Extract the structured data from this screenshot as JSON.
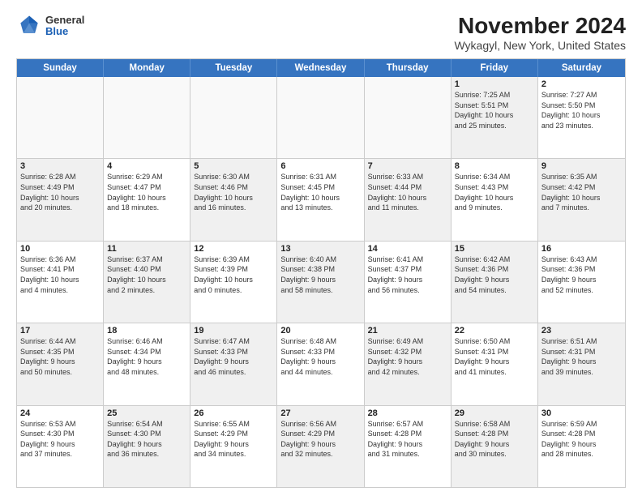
{
  "logo": {
    "general": "General",
    "blue": "Blue"
  },
  "title": "November 2024",
  "subtitle": "Wykagyl, New York, United States",
  "header": {
    "days": [
      "Sunday",
      "Monday",
      "Tuesday",
      "Wednesday",
      "Thursday",
      "Friday",
      "Saturday"
    ]
  },
  "weeks": [
    [
      {
        "day": "",
        "info": "",
        "empty": true
      },
      {
        "day": "",
        "info": "",
        "empty": true
      },
      {
        "day": "",
        "info": "",
        "empty": true
      },
      {
        "day": "",
        "info": "",
        "empty": true
      },
      {
        "day": "",
        "info": "",
        "empty": true
      },
      {
        "day": "1",
        "info": "Sunrise: 7:25 AM\nSunset: 5:51 PM\nDaylight: 10 hours\nand 25 minutes.",
        "shaded": true
      },
      {
        "day": "2",
        "info": "Sunrise: 7:27 AM\nSunset: 5:50 PM\nDaylight: 10 hours\nand 23 minutes.",
        "shaded": false
      }
    ],
    [
      {
        "day": "3",
        "info": "Sunrise: 6:28 AM\nSunset: 4:49 PM\nDaylight: 10 hours\nand 20 minutes.",
        "shaded": true
      },
      {
        "day": "4",
        "info": "Sunrise: 6:29 AM\nSunset: 4:47 PM\nDaylight: 10 hours\nand 18 minutes.",
        "shaded": false
      },
      {
        "day": "5",
        "info": "Sunrise: 6:30 AM\nSunset: 4:46 PM\nDaylight: 10 hours\nand 16 minutes.",
        "shaded": true
      },
      {
        "day": "6",
        "info": "Sunrise: 6:31 AM\nSunset: 4:45 PM\nDaylight: 10 hours\nand 13 minutes.",
        "shaded": false
      },
      {
        "day": "7",
        "info": "Sunrise: 6:33 AM\nSunset: 4:44 PM\nDaylight: 10 hours\nand 11 minutes.",
        "shaded": true
      },
      {
        "day": "8",
        "info": "Sunrise: 6:34 AM\nSunset: 4:43 PM\nDaylight: 10 hours\nand 9 minutes.",
        "shaded": false
      },
      {
        "day": "9",
        "info": "Sunrise: 6:35 AM\nSunset: 4:42 PM\nDaylight: 10 hours\nand 7 minutes.",
        "shaded": true
      }
    ],
    [
      {
        "day": "10",
        "info": "Sunrise: 6:36 AM\nSunset: 4:41 PM\nDaylight: 10 hours\nand 4 minutes.",
        "shaded": false
      },
      {
        "day": "11",
        "info": "Sunrise: 6:37 AM\nSunset: 4:40 PM\nDaylight: 10 hours\nand 2 minutes.",
        "shaded": true
      },
      {
        "day": "12",
        "info": "Sunrise: 6:39 AM\nSunset: 4:39 PM\nDaylight: 10 hours\nand 0 minutes.",
        "shaded": false
      },
      {
        "day": "13",
        "info": "Sunrise: 6:40 AM\nSunset: 4:38 PM\nDaylight: 9 hours\nand 58 minutes.",
        "shaded": true
      },
      {
        "day": "14",
        "info": "Sunrise: 6:41 AM\nSunset: 4:37 PM\nDaylight: 9 hours\nand 56 minutes.",
        "shaded": false
      },
      {
        "day": "15",
        "info": "Sunrise: 6:42 AM\nSunset: 4:36 PM\nDaylight: 9 hours\nand 54 minutes.",
        "shaded": true
      },
      {
        "day": "16",
        "info": "Sunrise: 6:43 AM\nSunset: 4:36 PM\nDaylight: 9 hours\nand 52 minutes.",
        "shaded": false
      }
    ],
    [
      {
        "day": "17",
        "info": "Sunrise: 6:44 AM\nSunset: 4:35 PM\nDaylight: 9 hours\nand 50 minutes.",
        "shaded": true
      },
      {
        "day": "18",
        "info": "Sunrise: 6:46 AM\nSunset: 4:34 PM\nDaylight: 9 hours\nand 48 minutes.",
        "shaded": false
      },
      {
        "day": "19",
        "info": "Sunrise: 6:47 AM\nSunset: 4:33 PM\nDaylight: 9 hours\nand 46 minutes.",
        "shaded": true
      },
      {
        "day": "20",
        "info": "Sunrise: 6:48 AM\nSunset: 4:33 PM\nDaylight: 9 hours\nand 44 minutes.",
        "shaded": false
      },
      {
        "day": "21",
        "info": "Sunrise: 6:49 AM\nSunset: 4:32 PM\nDaylight: 9 hours\nand 42 minutes.",
        "shaded": true
      },
      {
        "day": "22",
        "info": "Sunrise: 6:50 AM\nSunset: 4:31 PM\nDaylight: 9 hours\nand 41 minutes.",
        "shaded": false
      },
      {
        "day": "23",
        "info": "Sunrise: 6:51 AM\nSunset: 4:31 PM\nDaylight: 9 hours\nand 39 minutes.",
        "shaded": true
      }
    ],
    [
      {
        "day": "24",
        "info": "Sunrise: 6:53 AM\nSunset: 4:30 PM\nDaylight: 9 hours\nand 37 minutes.",
        "shaded": false
      },
      {
        "day": "25",
        "info": "Sunrise: 6:54 AM\nSunset: 4:30 PM\nDaylight: 9 hours\nand 36 minutes.",
        "shaded": true
      },
      {
        "day": "26",
        "info": "Sunrise: 6:55 AM\nSunset: 4:29 PM\nDaylight: 9 hours\nand 34 minutes.",
        "shaded": false
      },
      {
        "day": "27",
        "info": "Sunrise: 6:56 AM\nSunset: 4:29 PM\nDaylight: 9 hours\nand 32 minutes.",
        "shaded": true
      },
      {
        "day": "28",
        "info": "Sunrise: 6:57 AM\nSunset: 4:28 PM\nDaylight: 9 hours\nand 31 minutes.",
        "shaded": false
      },
      {
        "day": "29",
        "info": "Sunrise: 6:58 AM\nSunset: 4:28 PM\nDaylight: 9 hours\nand 30 minutes.",
        "shaded": true
      },
      {
        "day": "30",
        "info": "Sunrise: 6:59 AM\nSunset: 4:28 PM\nDaylight: 9 hours\nand 28 minutes.",
        "shaded": false
      }
    ]
  ]
}
